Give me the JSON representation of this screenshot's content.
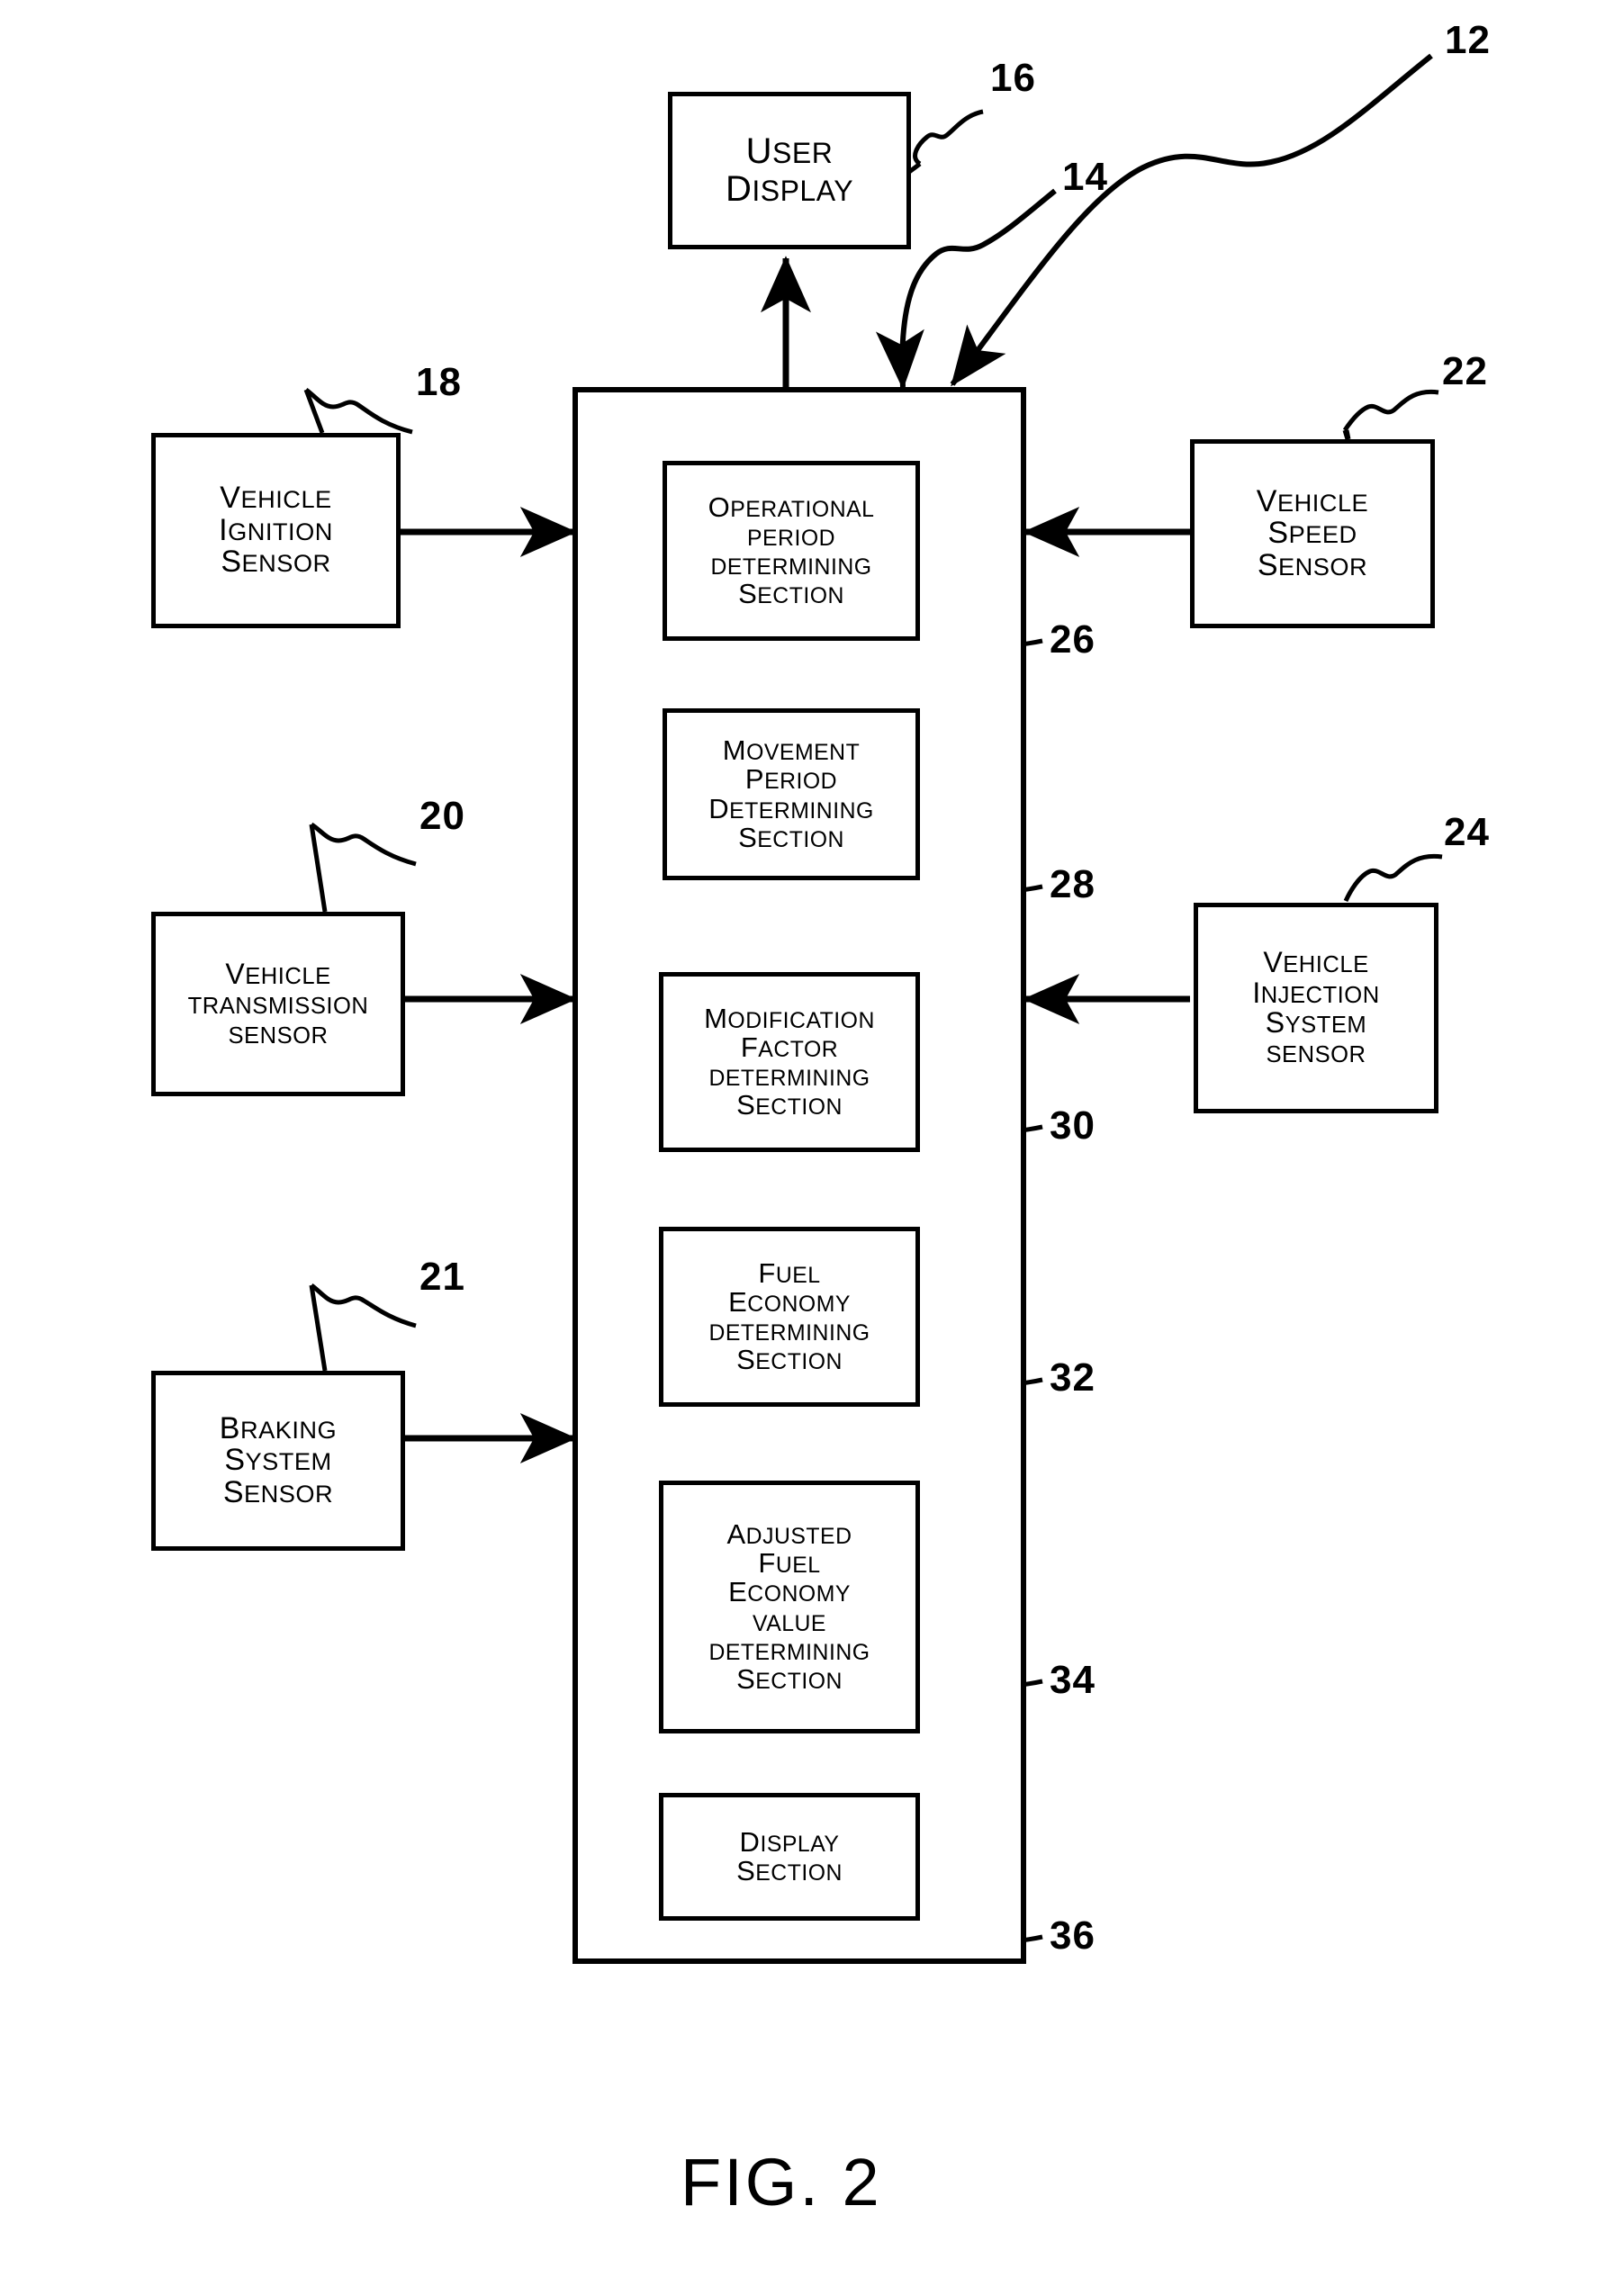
{
  "figure": {
    "caption": "FIG. 2",
    "system_ref": "12",
    "controller_ref": "14"
  },
  "user_display": {
    "ref": "16",
    "lines": [
      {
        "cap": "U",
        "sm": "SER"
      },
      {
        "cap": "D",
        "sm": "ISPLAY"
      }
    ]
  },
  "left_sensors": [
    {
      "ref": "18",
      "name": "vehicle-ignition-sensor",
      "lines": [
        {
          "cap": "V",
          "sm": "EHICLE"
        },
        {
          "cap": "I",
          "sm": "GNITION"
        },
        {
          "cap": "S",
          "sm": "ENSOR"
        }
      ]
    },
    {
      "ref": "20",
      "name": "vehicle-transmission-sensor",
      "lines": [
        {
          "cap": "V",
          "sm": "EHICLE"
        },
        {
          "cap": "",
          "sm": "TRANSMISSION"
        },
        {
          "cap": "",
          "sm": "SENSOR"
        }
      ]
    },
    {
      "ref": "21",
      "name": "braking-system-sensor",
      "lines": [
        {
          "cap": "B",
          "sm": "RAKING"
        },
        {
          "cap": "S",
          "sm": "YSTEM"
        },
        {
          "cap": "S",
          "sm": "ENSOR"
        }
      ]
    }
  ],
  "right_sensors": [
    {
      "ref": "22",
      "name": "vehicle-speed-sensor",
      "lines": [
        {
          "cap": "V",
          "sm": "EHICLE"
        },
        {
          "cap": "S",
          "sm": "PEED"
        },
        {
          "cap": "S",
          "sm": "ENSOR"
        }
      ]
    },
    {
      "ref": "24",
      "name": "vehicle-injection-system-sensor",
      "lines": [
        {
          "cap": "V",
          "sm": "EHICLE"
        },
        {
          "cap": "I",
          "sm": "NJECTION"
        },
        {
          "cap": "S",
          "sm": "YSTEM"
        },
        {
          "cap": "",
          "sm": "SENSOR"
        }
      ]
    }
  ],
  "controller_sections": [
    {
      "ref": "26",
      "name": "operational-period-determining-section",
      "lines": [
        {
          "cap": "O",
          "sm": "PERATIONAL"
        },
        {
          "cap": "",
          "sm": "PERIOD"
        },
        {
          "cap": "",
          "sm": "DETERMINING"
        },
        {
          "cap": "S",
          "sm": "ECTION"
        }
      ]
    },
    {
      "ref": "28",
      "name": "movement-period-determining-section",
      "lines": [
        {
          "cap": "M",
          "sm": "OVEMENT"
        },
        {
          "cap": "P",
          "sm": "ERIOD"
        },
        {
          "cap": "D",
          "sm": "ETERMINING"
        },
        {
          "cap": "S",
          "sm": "ECTION"
        }
      ]
    },
    {
      "ref": "30",
      "name": "modification-factor-determining-section",
      "lines": [
        {
          "cap": "M",
          "sm": "ODIFICATION"
        },
        {
          "cap": "F",
          "sm": "ACTOR"
        },
        {
          "cap": "",
          "sm": "DETERMINING"
        },
        {
          "cap": "S",
          "sm": "ECTION"
        }
      ]
    },
    {
      "ref": "32",
      "name": "fuel-economy-determining-section",
      "lines": [
        {
          "cap": "F",
          "sm": "UEL"
        },
        {
          "cap": "E",
          "sm": "CONOMY"
        },
        {
          "cap": "",
          "sm": "DETERMINING"
        },
        {
          "cap": "S",
          "sm": "ECTION"
        }
      ]
    },
    {
      "ref": "34",
      "name": "adjusted-fuel-economy-value-determining-section",
      "lines": [
        {
          "cap": "A",
          "sm": "DJUSTED"
        },
        {
          "cap": "F",
          "sm": "UEL"
        },
        {
          "cap": "E",
          "sm": "CONOMY"
        },
        {
          "cap": "",
          "sm": "VALUE"
        },
        {
          "cap": "",
          "sm": "DETERMINING"
        },
        {
          "cap": "S",
          "sm": "ECTION"
        }
      ]
    },
    {
      "ref": "36",
      "name": "display-section",
      "lines": [
        {
          "cap": "D",
          "sm": "ISPLAY"
        },
        {
          "cap": "S",
          "sm": "ECTION"
        }
      ]
    }
  ],
  "colors": {
    "ink": "#000000",
    "paper": "#ffffff"
  }
}
